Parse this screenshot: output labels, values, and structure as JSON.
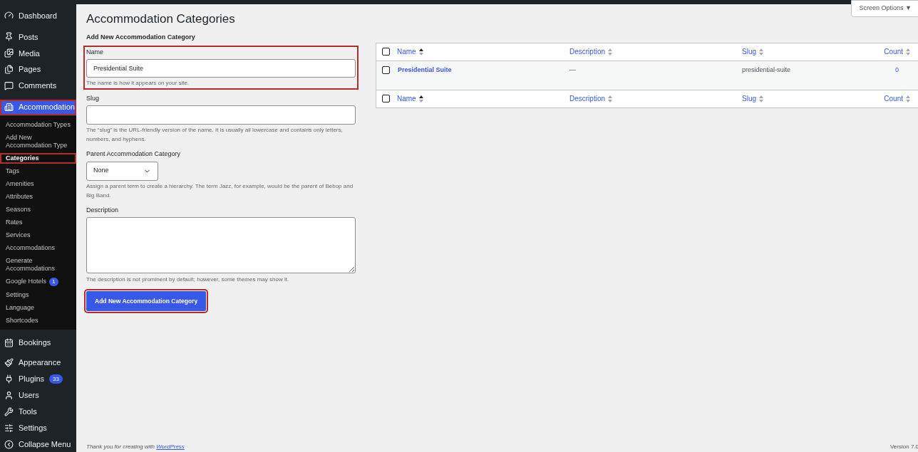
{
  "sidebar": {
    "items_top": [
      {
        "label": "Dashboard",
        "selected": false
      },
      {
        "label": "Posts",
        "selected": false
      },
      {
        "label": "Media",
        "selected": false
      },
      {
        "label": "Pages",
        "selected": false
      },
      {
        "label": "Comments",
        "selected": false
      },
      {
        "label": "Accommodation",
        "selected": true,
        "highlighted": true
      }
    ],
    "submenu": [
      {
        "label": "Accommodation Types",
        "selected": false,
        "highlighted": false
      },
      {
        "label": "Add New Accommodation Type",
        "selected": false,
        "highlighted": false
      },
      {
        "label": "Categories",
        "selected": true,
        "highlighted": true
      },
      {
        "label": "Tags",
        "selected": false,
        "highlighted": false
      },
      {
        "label": "Amenities",
        "selected": false,
        "highlighted": false
      },
      {
        "label": "Attributes",
        "selected": false,
        "highlighted": false
      },
      {
        "label": "Seasons",
        "selected": false,
        "highlighted": false
      },
      {
        "label": "Rates",
        "selected": false,
        "highlighted": false
      },
      {
        "label": "Services",
        "selected": false,
        "highlighted": false
      },
      {
        "label": "Accommodations",
        "selected": false,
        "highlighted": false
      },
      {
        "label": "Generate Accommodations",
        "selected": false,
        "highlighted": false
      },
      {
        "label": "Google Hotels",
        "badge": "1",
        "selected": false,
        "highlighted": false
      },
      {
        "label": "Settings",
        "selected": false,
        "highlighted": false
      },
      {
        "label": "Language",
        "selected": false,
        "highlighted": false
      },
      {
        "label": "Shortcodes",
        "selected": false,
        "highlighted": false
      }
    ],
    "items_bottom": [
      {
        "label": "Bookings",
        "selected": false
      },
      {
        "label": "Appearance",
        "selected": false
      },
      {
        "label": "Plugins",
        "badge": "33",
        "selected": false
      },
      {
        "label": "Users",
        "selected": false
      },
      {
        "label": "Tools",
        "selected": false
      },
      {
        "label": "Settings",
        "selected": false
      },
      {
        "label": "Collapse Menu",
        "selected": false
      }
    ]
  },
  "screen_options": "Screen Options ▼",
  "page_title": "Accommodation Categories",
  "form": {
    "heading": "Add New Accommodation Category",
    "name": {
      "label": "Name",
      "value": "Presidential Suite",
      "help": "The name is how it appears on your site.",
      "highlighted": true
    },
    "slug": {
      "label": "Slug",
      "help": "The “slug” is the URL-friendly version of the name. It is usually all lowercase and contains only letters, numbers, and hyphens."
    },
    "parent": {
      "label": "Parent Accommodation Category",
      "value": "None",
      "help": "Assign a parent term to create a hierarchy. The term Jazz, for example, would be the parent of Bebop and Big Band."
    },
    "description": {
      "label": "Description",
      "help": "The description is not prominent by default; however, some themes may show it."
    },
    "submit": {
      "label": "Add New Accommodation Category",
      "highlighted": true
    }
  },
  "table": {
    "header": {
      "checked": false,
      "columns": [
        {
          "label": "Name",
          "sorted": true
        },
        {
          "label": "Description",
          "sorted": false
        },
        {
          "label": "Slug",
          "sorted": false
        },
        {
          "label": "Count",
          "sorted": false
        }
      ]
    },
    "rows": [
      {
        "checked": false,
        "name": "Presidential Suite",
        "description": "—",
        "slug": "presidential-suite",
        "count": "0"
      }
    ],
    "footer": {
      "checked": false,
      "columns": [
        {
          "label": "Name",
          "sorted": true
        },
        {
          "label": "Description",
          "sorted": false
        },
        {
          "label": "Slug",
          "sorted": false
        },
        {
          "label": "Count",
          "sorted": false
        }
      ]
    }
  },
  "footer": {
    "thanks": "Thank you for creating with ",
    "link": "WordPress",
    "version": "Version 7.0"
  }
}
